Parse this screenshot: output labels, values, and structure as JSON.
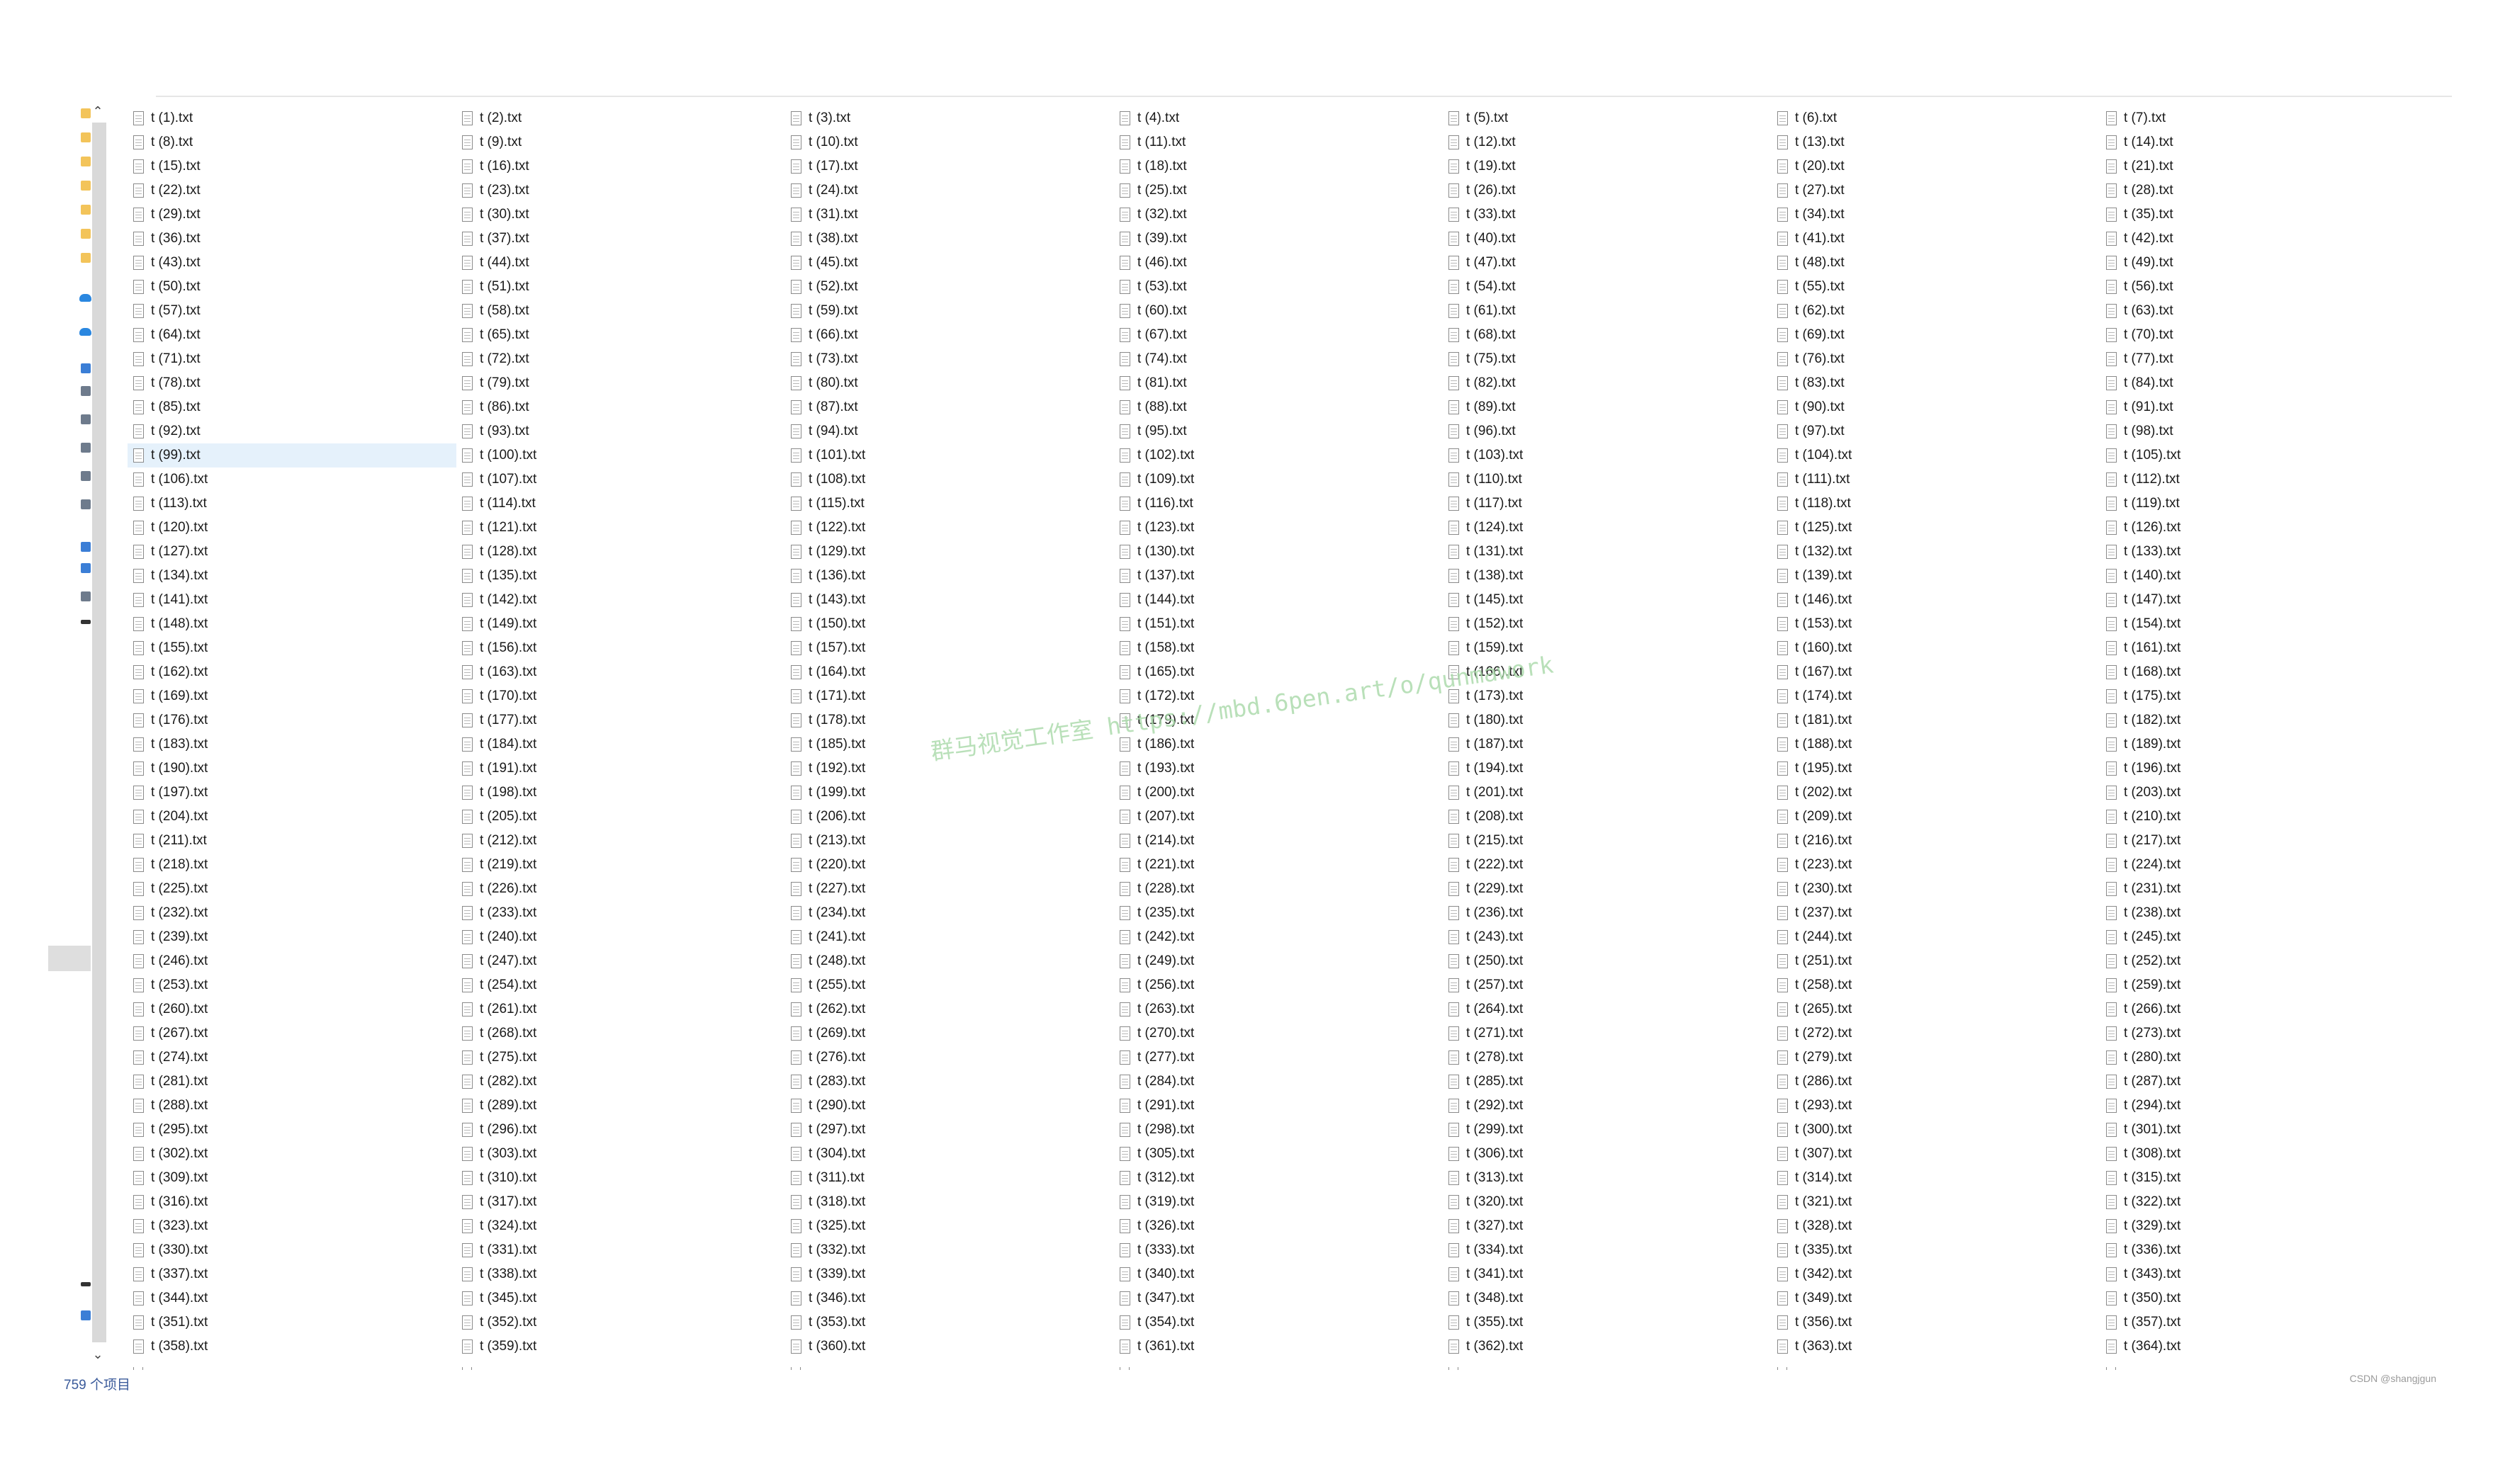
{
  "explorer": {
    "status": {
      "item_count": "759 个项目"
    },
    "selected_file": "t (99).txt",
    "files": [
      "t (1).txt",
      "t (2).txt",
      "t (3).txt",
      "t (4).txt",
      "t (5).txt",
      "t (6).txt",
      "t (7).txt",
      "t (8).txt",
      "t (9).txt",
      "t (10).txt",
      "t (11).txt",
      "t (12).txt",
      "t (13).txt",
      "t (14).txt",
      "t (15).txt",
      "t (16).txt",
      "t (17).txt",
      "t (18).txt",
      "t (19).txt",
      "t (20).txt",
      "t (21).txt",
      "t (22).txt",
      "t (23).txt",
      "t (24).txt",
      "t (25).txt",
      "t (26).txt",
      "t (27).txt",
      "t (28).txt",
      "t (29).txt",
      "t (30).txt",
      "t (31).txt",
      "t (32).txt",
      "t (33).txt",
      "t (34).txt",
      "t (35).txt",
      "t (36).txt",
      "t (37).txt",
      "t (38).txt",
      "t (39).txt",
      "t (40).txt",
      "t (41).txt",
      "t (42).txt",
      "t (43).txt",
      "t (44).txt",
      "t (45).txt",
      "t (46).txt",
      "t (47).txt",
      "t (48).txt",
      "t (49).txt",
      "t (50).txt",
      "t (51).txt",
      "t (52).txt",
      "t (53).txt",
      "t (54).txt",
      "t (55).txt",
      "t (56).txt",
      "t (57).txt",
      "t (58).txt",
      "t (59).txt",
      "t (60).txt",
      "t (61).txt",
      "t (62).txt",
      "t (63).txt",
      "t (64).txt",
      "t (65).txt",
      "t (66).txt",
      "t (67).txt",
      "t (68).txt",
      "t (69).txt",
      "t (70).txt",
      "t (71).txt",
      "t (72).txt",
      "t (73).txt",
      "t (74).txt",
      "t (75).txt",
      "t (76).txt",
      "t (77).txt",
      "t (78).txt",
      "t (79).txt",
      "t (80).txt",
      "t (81).txt",
      "t (82).txt",
      "t (83).txt",
      "t (84).txt",
      "t (85).txt",
      "t (86).txt",
      "t (87).txt",
      "t (88).txt",
      "t (89).txt",
      "t (90).txt",
      "t (91).txt",
      "t (92).txt",
      "t (93).txt",
      "t (94).txt",
      "t (95).txt",
      "t (96).txt",
      "t (97).txt",
      "t (98).txt",
      "t (99).txt",
      "t (100).txt",
      "t (101).txt",
      "t (102).txt",
      "t (103).txt",
      "t (104).txt",
      "t (105).txt",
      "t (106).txt",
      "t (107).txt",
      "t (108).txt",
      "t (109).txt",
      "t (110).txt",
      "t (111).txt",
      "t (112).txt",
      "t (113).txt",
      "t (114).txt",
      "t (115).txt",
      "t (116).txt",
      "t (117).txt",
      "t (118).txt",
      "t (119).txt",
      "t (120).txt",
      "t (121).txt",
      "t (122).txt",
      "t (123).txt",
      "t (124).txt",
      "t (125).txt",
      "t (126).txt",
      "t (127).txt",
      "t (128).txt",
      "t (129).txt",
      "t (130).txt",
      "t (131).txt",
      "t (132).txt",
      "t (133).txt",
      "t (134).txt",
      "t (135).txt",
      "t (136).txt",
      "t (137).txt",
      "t (138).txt",
      "t (139).txt",
      "t (140).txt",
      "t (141).txt",
      "t (142).txt",
      "t (143).txt",
      "t (144).txt",
      "t (145).txt",
      "t (146).txt",
      "t (147).txt",
      "t (148).txt",
      "t (149).txt",
      "t (150).txt",
      "t (151).txt",
      "t (152).txt",
      "t (153).txt",
      "t (154).txt",
      "t (155).txt",
      "t (156).txt",
      "t (157).txt",
      "t (158).txt",
      "t (159).txt",
      "t (160).txt",
      "t (161).txt",
      "t (162).txt",
      "t (163).txt",
      "t (164).txt",
      "t (165).txt",
      "t (166).txt",
      "t (167).txt",
      "t (168).txt",
      "t (169).txt",
      "t (170).txt",
      "t (171).txt",
      "t (172).txt",
      "t (173).txt",
      "t (174).txt",
      "t (175).txt",
      "t (176).txt",
      "t (177).txt",
      "t (178).txt",
      "t (179).txt",
      "t (180).txt",
      "t (181).txt",
      "t (182).txt",
      "t (183).txt",
      "t (184).txt",
      "t (185).txt",
      "t (186).txt",
      "t (187).txt",
      "t (188).txt",
      "t (189).txt",
      "t (190).txt",
      "t (191).txt",
      "t (192).txt",
      "t (193).txt",
      "t (194).txt",
      "t (195).txt",
      "t (196).txt",
      "t (197).txt",
      "t (198).txt",
      "t (199).txt",
      "t (200).txt",
      "t (201).txt",
      "t (202).txt",
      "t (203).txt",
      "t (204).txt",
      "t (205).txt",
      "t (206).txt",
      "t (207).txt",
      "t (208).txt",
      "t (209).txt",
      "t (210).txt",
      "t (211).txt",
      "t (212).txt",
      "t (213).txt",
      "t (214).txt",
      "t (215).txt",
      "t (216).txt",
      "t (217).txt",
      "t (218).txt",
      "t (219).txt",
      "t (220).txt",
      "t (221).txt",
      "t (222).txt",
      "t (223).txt",
      "t (224).txt",
      "t (225).txt",
      "t (226).txt",
      "t (227).txt",
      "t (228).txt",
      "t (229).txt",
      "t (230).txt",
      "t (231).txt",
      "t (232).txt",
      "t (233).txt",
      "t (234).txt",
      "t (235).txt",
      "t (236).txt",
      "t (237).txt",
      "t (238).txt",
      "t (239).txt",
      "t (240).txt",
      "t (241).txt",
      "t (242).txt",
      "t (243).txt",
      "t (244).txt",
      "t (245).txt",
      "t (246).txt",
      "t (247).txt",
      "t (248).txt",
      "t (249).txt",
      "t (250).txt",
      "t (251).txt",
      "t (252).txt",
      "t (253).txt",
      "t (254).txt",
      "t (255).txt",
      "t (256).txt",
      "t (257).txt",
      "t (258).txt",
      "t (259).txt",
      "t (260).txt",
      "t (261).txt",
      "t (262).txt",
      "t (263).txt",
      "t (264).txt",
      "t (265).txt",
      "t (266).txt",
      "t (267).txt",
      "t (268).txt",
      "t (269).txt",
      "t (270).txt",
      "t (271).txt",
      "t (272).txt",
      "t (273).txt",
      "t (274).txt",
      "t (275).txt",
      "t (276).txt",
      "t (277).txt",
      "t (278).txt",
      "t (279).txt",
      "t (280).txt",
      "t (281).txt",
      "t (282).txt",
      "t (283).txt",
      "t (284).txt",
      "t (285).txt",
      "t (286).txt",
      "t (287).txt",
      "t (288).txt",
      "t (289).txt",
      "t (290).txt",
      "t (291).txt",
      "t (292).txt",
      "t (293).txt",
      "t (294).txt",
      "t (295).txt",
      "t (296).txt",
      "t (297).txt",
      "t (298).txt",
      "t (299).txt",
      "t (300).txt",
      "t (301).txt",
      "t (302).txt",
      "t (303).txt",
      "t (304).txt",
      "t (305).txt",
      "t (306).txt",
      "t (307).txt",
      "t (308).txt",
      "t (309).txt",
      "t (310).txt",
      "t (311).txt",
      "t (312).txt",
      "t (313).txt",
      "t (314).txt",
      "t (315).txt",
      "t (316).txt",
      "t (317).txt",
      "t (318).txt",
      "t (319).txt",
      "t (320).txt",
      "t (321).txt",
      "t (322).txt",
      "t (323).txt",
      "t (324).txt",
      "t (325).txt",
      "t (326).txt",
      "t (327).txt",
      "t (328).txt",
      "t (329).txt",
      "t (330).txt",
      "t (331).txt",
      "t (332).txt",
      "t (333).txt",
      "t (334).txt",
      "t (335).txt",
      "t (336).txt",
      "t (337).txt",
      "t (338).txt",
      "t (339).txt",
      "t (340).txt",
      "t (341).txt",
      "t (342).txt",
      "t (343).txt",
      "t (344).txt",
      "t (345).txt",
      "t (346).txt",
      "t (347).txt",
      "t (348).txt",
      "t (349).txt",
      "t (350).txt",
      "t (351).txt",
      "t (352).txt",
      "t (353).txt",
      "t (354).txt",
      "t (355).txt",
      "t (356).txt",
      "t (357).txt",
      "t (358).txt",
      "t (359).txt",
      "t (360).txt",
      "t (361).txt",
      "t (362).txt",
      "t (363).txt",
      "t (364).txt"
    ]
  },
  "watermark": {
    "text_cn": "群马视觉工作室",
    "text_url": "https://mbd.6pen.art/o/qunmawork"
  },
  "credit": "CSDN @shangjgun",
  "icons": {
    "file": "text-file-icon",
    "scroll_up": "chevron-up-icon",
    "scroll_down": "chevron-down-icon"
  }
}
